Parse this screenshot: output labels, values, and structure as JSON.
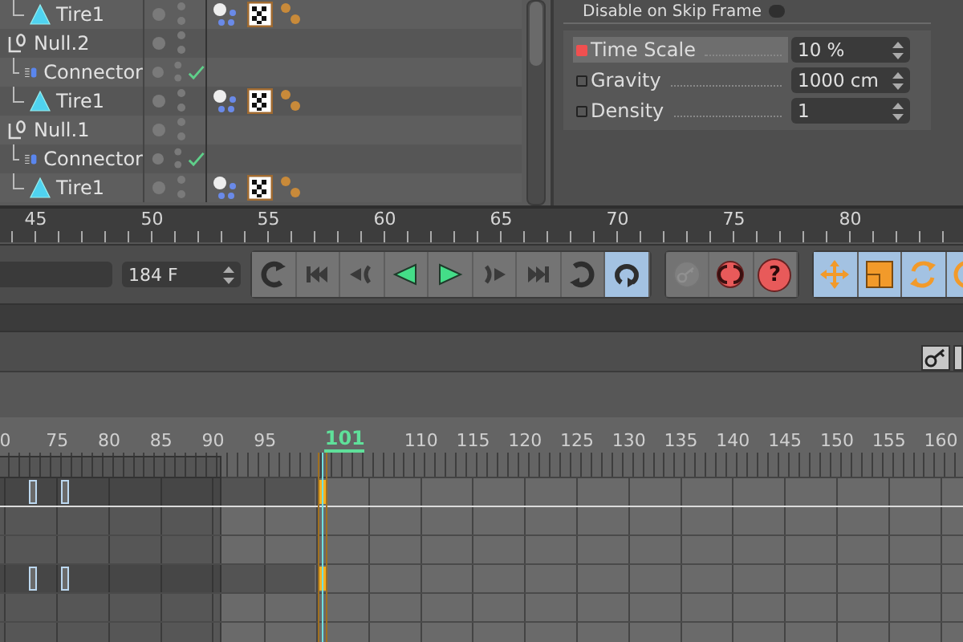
{
  "objects": [
    {
      "children": [
        {
          "name": "Tire1",
          "kind": "tire",
          "tags": [
            {
              "kind": "dynamics"
            },
            {
              "kind": "texture"
            },
            {
              "kind": "material"
            }
          ]
        }
      ]
    },
    {
      "name": "Null.2",
      "kind": "null",
      "children": [
        {
          "name": "Connector",
          "kind": "connector",
          "enabled": true
        },
        {
          "name": "Tire1",
          "kind": "tire",
          "tags": [
            {
              "kind": "dynamics"
            },
            {
              "kind": "texture"
            },
            {
              "kind": "material"
            }
          ]
        }
      ]
    },
    {
      "name": "Null.1",
      "kind": "null",
      "children": [
        {
          "name": "Connector",
          "kind": "connector",
          "enabled": true
        },
        {
          "name": "Tire1",
          "kind": "tire",
          "tags": [
            {
              "kind": "dynamics"
            },
            {
              "kind": "texture"
            },
            {
              "kind": "material"
            }
          ]
        }
      ]
    }
  ],
  "attributes": {
    "checkbox": {
      "label": "Disable on Skip Frame",
      "checked": false
    },
    "params": [
      {
        "label": "Time Scale",
        "value": "10 %",
        "selected": true,
        "keyed": true
      },
      {
        "label": "Gravity",
        "value": "1000 cm",
        "selected": false,
        "keyed": false
      },
      {
        "label": "Density",
        "value": "1",
        "selected": false,
        "keyed": false
      }
    ]
  },
  "ruler": {
    "labels": [
      "45",
      "50",
      "55",
      "60",
      "65",
      "70",
      "75",
      "80"
    ]
  },
  "transport": {
    "frame_field": {
      "value": "184 F"
    },
    "groups": [
      [
        {
          "kind": "loop-start",
          "selected": false
        },
        {
          "kind": "first",
          "selected": false
        },
        {
          "kind": "prev-key",
          "selected": false
        },
        {
          "kind": "play-back",
          "selected": false
        },
        {
          "kind": "play",
          "selected": false
        },
        {
          "kind": "next-key",
          "selected": false
        },
        {
          "kind": "last",
          "selected": false
        },
        {
          "kind": "loop-end",
          "selected": false
        },
        {
          "kind": "loop-mode",
          "selected": true
        }
      ],
      [
        {
          "kind": "record-key",
          "selected": false,
          "disabled": true
        },
        {
          "kind": "autokey",
          "selected": false,
          "disabled": false
        },
        {
          "kind": "help",
          "selected": false,
          "disabled": false,
          "glyph": "?"
        }
      ],
      [
        {
          "kind": "move",
          "selected": true
        },
        {
          "kind": "scale",
          "selected": true
        },
        {
          "kind": "rotate",
          "selected": true
        },
        {
          "kind": "circle",
          "selected": true
        }
      ]
    ]
  },
  "timeline": {
    "labels_before": [
      "0",
      "75",
      "80",
      "85",
      "90",
      "95"
    ],
    "current_frame": "101",
    "labels_after": [
      "110",
      "115",
      "120",
      "125",
      "130",
      "135",
      "140",
      "145",
      "150",
      "155",
      "160"
    ],
    "tracks": [
      {
        "keys": [
          {
            "selected": false
          },
          {
            "selected": false
          },
          {
            "selected": true
          }
        ]
      },
      {
        "keys": [
          {
            "selected": false
          },
          {
            "selected": false
          },
          {
            "selected": true
          }
        ]
      }
    ]
  }
}
